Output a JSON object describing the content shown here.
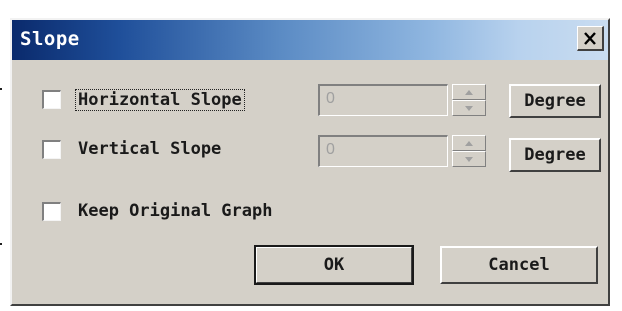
{
  "dialog": {
    "title": "Slope"
  },
  "icons": {
    "close": "close-icon",
    "spin_up": "spin-up-arrow-icon",
    "spin_down": "spin-down-arrow-icon"
  },
  "horizontal": {
    "label": "Horizontal Slope",
    "checked": false,
    "value": "0",
    "unit": "Degree"
  },
  "vertical": {
    "label": "Vertical Slope",
    "checked": false,
    "value": "0",
    "unit": "Degree"
  },
  "keep": {
    "label": "Keep Original Graph",
    "checked": false
  },
  "buttons": {
    "ok": "OK",
    "cancel": "Cancel"
  },
  "colors": {
    "face": "#d4d0c8",
    "title_start": "#0a2a6c",
    "title_end": "#c9dcf0"
  }
}
